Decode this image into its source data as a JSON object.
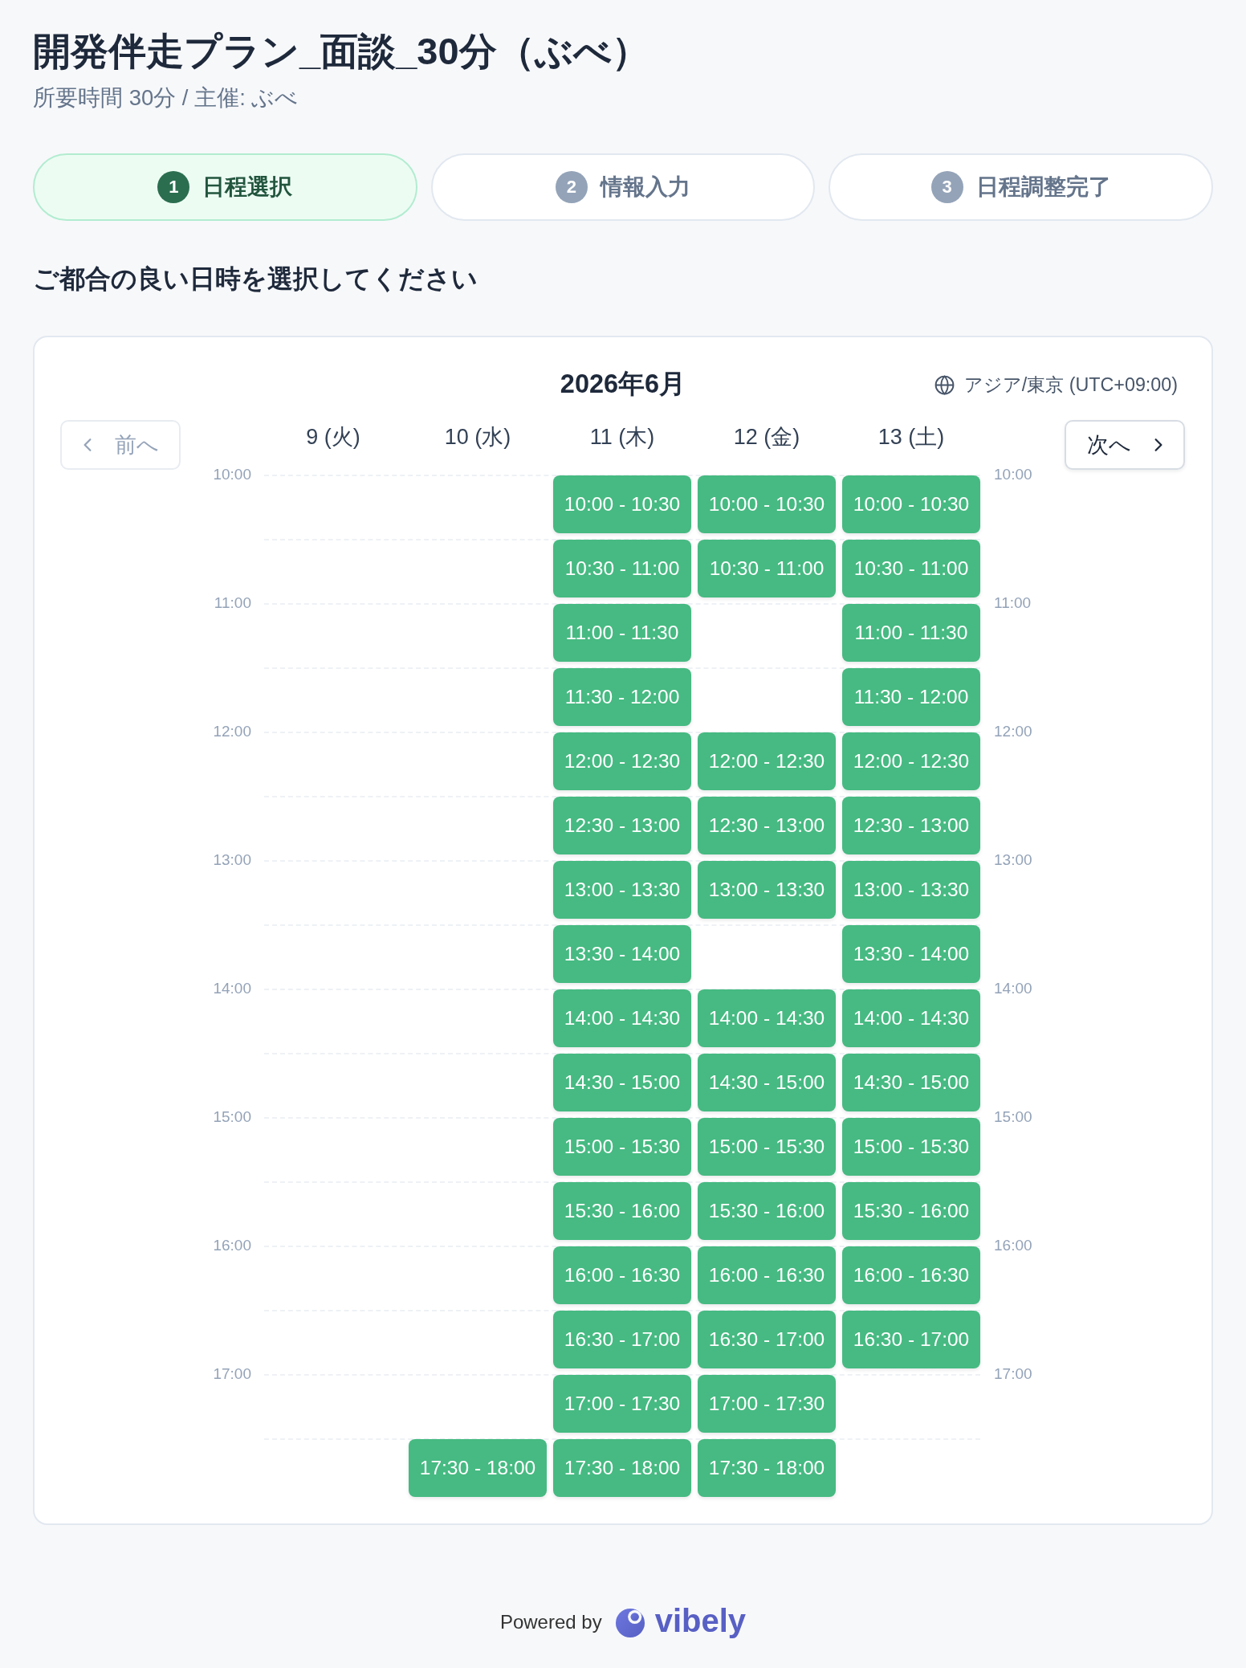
{
  "event": {
    "title": "開発伴走プラン_面談_30分（ぶべ）",
    "subtitle": "所要時間 30分 / 主催: ぶべ"
  },
  "steps": [
    {
      "number": "1",
      "label": "日程選択",
      "selected": true
    },
    {
      "number": "2",
      "label": "情報入力",
      "selected": false
    },
    {
      "number": "3",
      "label": "日程調整完了",
      "selected": false
    }
  ],
  "prompt": "ご都合の良い日時を選択してください",
  "calendar": {
    "month": "2026年6月",
    "timezone": "アジア/東京 (UTC+09:00)",
    "prev_button": {
      "label": "前へ",
      "disabled": true
    },
    "next_button": {
      "label": "次へ",
      "disabled": false
    },
    "days": [
      "9 (火)",
      "10 (水)",
      "11 (木)",
      "12 (金)",
      "13 (土)"
    ],
    "time_rows": [
      {
        "label_left": "10:00",
        "label_right": "10:00",
        "cells": [
          {
            "kind": "empty"
          },
          {
            "kind": "empty"
          },
          {
            "kind": "slot",
            "label": "10:00 - 10:30"
          },
          {
            "kind": "slot",
            "label": "10:00 - 10:30"
          },
          {
            "kind": "slot",
            "label": "10:00 - 10:30"
          }
        ]
      },
      {
        "cells": [
          {
            "kind": "empty"
          },
          {
            "kind": "empty"
          },
          {
            "kind": "slot",
            "label": "10:30 - 11:00"
          },
          {
            "kind": "slot",
            "label": "10:30 - 11:00"
          },
          {
            "kind": "slot",
            "label": "10:30 - 11:00"
          }
        ]
      },
      {
        "label_left": "11:00",
        "label_right": "11:00",
        "cells": [
          {
            "kind": "empty"
          },
          {
            "kind": "empty"
          },
          {
            "kind": "slot",
            "label": "11:00 - 11:30"
          },
          {
            "kind": "empty"
          },
          {
            "kind": "slot",
            "label": "11:00 - 11:30"
          }
        ]
      },
      {
        "cells": [
          {
            "kind": "empty"
          },
          {
            "kind": "empty"
          },
          {
            "kind": "slot",
            "label": "11:30 - 12:00"
          },
          {
            "kind": "empty"
          },
          {
            "kind": "slot",
            "label": "11:30 - 12:00"
          }
        ]
      },
      {
        "label_left": "12:00",
        "label_right": "12:00",
        "cells": [
          {
            "kind": "empty"
          },
          {
            "kind": "empty"
          },
          {
            "kind": "slot",
            "label": "12:00 - 12:30"
          },
          {
            "kind": "slot",
            "label": "12:00 - 12:30"
          },
          {
            "kind": "slot",
            "label": "12:00 - 12:30"
          }
        ]
      },
      {
        "cells": [
          {
            "kind": "empty"
          },
          {
            "kind": "empty"
          },
          {
            "kind": "slot",
            "label": "12:30 - 13:00"
          },
          {
            "kind": "slot",
            "label": "12:30 - 13:00"
          },
          {
            "kind": "slot",
            "label": "12:30 - 13:00"
          }
        ]
      },
      {
        "label_left": "13:00",
        "label_right": "13:00",
        "cells": [
          {
            "kind": "empty"
          },
          {
            "kind": "empty"
          },
          {
            "kind": "slot",
            "label": "13:00 - 13:30"
          },
          {
            "kind": "slot",
            "label": "13:00 - 13:30"
          },
          {
            "kind": "slot",
            "label": "13:00 - 13:30"
          }
        ]
      },
      {
        "cells": [
          {
            "kind": "empty"
          },
          {
            "kind": "empty"
          },
          {
            "kind": "slot",
            "label": "13:30 - 14:00"
          },
          {
            "kind": "empty"
          },
          {
            "kind": "slot",
            "label": "13:30 - 14:00"
          }
        ]
      },
      {
        "label_left": "14:00",
        "label_right": "14:00",
        "cells": [
          {
            "kind": "empty"
          },
          {
            "kind": "empty"
          },
          {
            "kind": "slot",
            "label": "14:00 - 14:30"
          },
          {
            "kind": "slot",
            "label": "14:00 - 14:30"
          },
          {
            "kind": "slot",
            "label": "14:00 - 14:30"
          }
        ]
      },
      {
        "cells": [
          {
            "kind": "empty"
          },
          {
            "kind": "empty"
          },
          {
            "kind": "slot",
            "label": "14:30 - 15:00"
          },
          {
            "kind": "slot",
            "label": "14:30 - 15:00"
          },
          {
            "kind": "slot",
            "label": "14:30 - 15:00"
          }
        ]
      },
      {
        "label_left": "15:00",
        "label_right": "15:00",
        "cells": [
          {
            "kind": "empty"
          },
          {
            "kind": "empty"
          },
          {
            "kind": "slot",
            "label": "15:00 - 15:30"
          },
          {
            "kind": "slot",
            "label": "15:00 - 15:30"
          },
          {
            "kind": "slot",
            "label": "15:00 - 15:30"
          }
        ]
      },
      {
        "cells": [
          {
            "kind": "empty"
          },
          {
            "kind": "empty"
          },
          {
            "kind": "slot",
            "label": "15:30 - 16:00"
          },
          {
            "kind": "slot",
            "label": "15:30 - 16:00"
          },
          {
            "kind": "slot",
            "label": "15:30 - 16:00"
          }
        ]
      },
      {
        "label_left": "16:00",
        "label_right": "16:00",
        "cells": [
          {
            "kind": "empty"
          },
          {
            "kind": "empty"
          },
          {
            "kind": "slot",
            "label": "16:00 - 16:30"
          },
          {
            "kind": "slot",
            "label": "16:00 - 16:30"
          },
          {
            "kind": "slot",
            "label": "16:00 - 16:30"
          }
        ]
      },
      {
        "cells": [
          {
            "kind": "empty"
          },
          {
            "kind": "empty"
          },
          {
            "kind": "slot",
            "label": "16:30 - 17:00"
          },
          {
            "kind": "slot",
            "label": "16:30 - 17:00"
          },
          {
            "kind": "slot",
            "label": "16:30 - 17:00"
          }
        ]
      },
      {
        "label_left": "17:00",
        "label_right": "17:00",
        "cells": [
          {
            "kind": "empty"
          },
          {
            "kind": "empty"
          },
          {
            "kind": "slot",
            "label": "17:00 - 17:30"
          },
          {
            "kind": "slot",
            "label": "17:00 - 17:30"
          },
          {
            "kind": "empty"
          }
        ]
      },
      {
        "cells": [
          {
            "kind": "empty"
          },
          {
            "kind": "slot",
            "label": "17:30 - 18:00"
          },
          {
            "kind": "slot",
            "label": "17:30 - 18:00"
          },
          {
            "kind": "slot",
            "label": "17:30 - 18:00"
          },
          {
            "kind": "empty"
          }
        ]
      }
    ]
  },
  "footer": {
    "powered_by": "Powered by",
    "brand": "vibely"
  }
}
